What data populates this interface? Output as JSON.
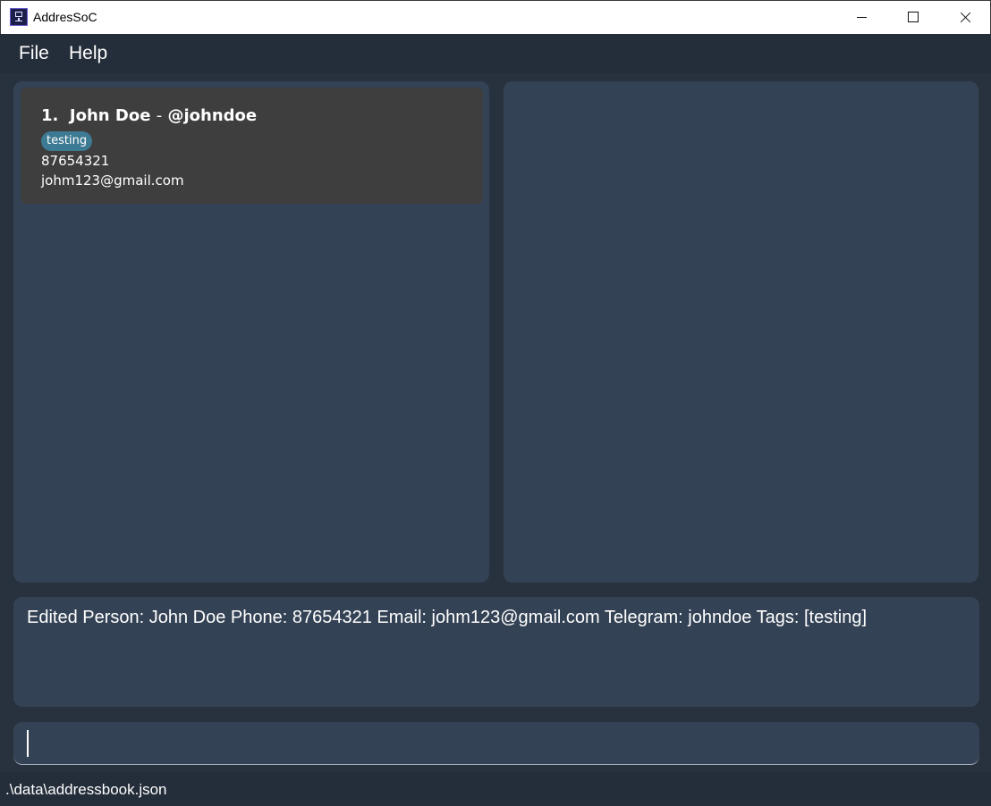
{
  "window": {
    "title": "AddresSoC"
  },
  "menu": {
    "items": [
      "File",
      "Help"
    ]
  },
  "person_list": {
    "items": [
      {
        "index": "1.",
        "name": "John Doe",
        "separator": "-",
        "telegram": "@johndoe",
        "tags": [
          "testing"
        ],
        "phone": "87654321",
        "email": "johm123@gmail.com"
      }
    ]
  },
  "result_display": {
    "text": "Edited Person: John Doe Phone: 87654321 Email: johm123@gmail.com Telegram: johndoe Tags: [testing]"
  },
  "command_box": {
    "value": ""
  },
  "status_bar": {
    "file_path": ".\\data\\addressbook.json"
  },
  "colors": {
    "background": "#28313e",
    "panel": "#344255",
    "card": "#3e3e3e",
    "tag": "#3d7a93"
  }
}
